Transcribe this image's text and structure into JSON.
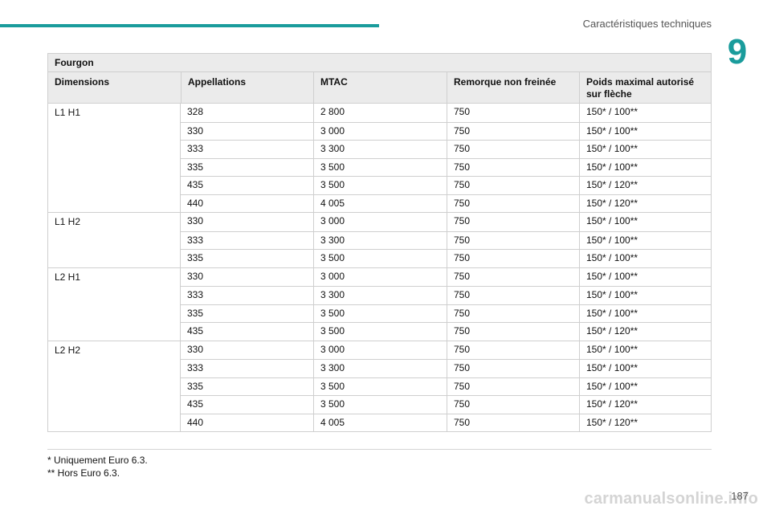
{
  "header": {
    "title": "Caractéristiques techniques",
    "chapter": "9"
  },
  "table": {
    "title": "Fourgon",
    "columns": [
      "Dimensions",
      "Appellations",
      "MTAC",
      "Remorque non freinée",
      "Poids maximal autorisé sur flèche"
    ],
    "groups": [
      {
        "dimension": "L1 H1",
        "rows": [
          [
            "328",
            "2 800",
            "750",
            "150* / 100**"
          ],
          [
            "330",
            "3 000",
            "750",
            "150* / 100**"
          ],
          [
            "333",
            "3 300",
            "750",
            "150* / 100**"
          ],
          [
            "335",
            "3 500",
            "750",
            "150* / 100**"
          ],
          [
            "435",
            "3 500",
            "750",
            "150* / 120**"
          ],
          [
            "440",
            "4 005",
            "750",
            "150* / 120**"
          ]
        ]
      },
      {
        "dimension": "L1 H2",
        "rows": [
          [
            "330",
            "3 000",
            "750",
            "150* / 100**"
          ],
          [
            "333",
            "3 300",
            "750",
            "150* / 100**"
          ],
          [
            "335",
            "3 500",
            "750",
            "150* / 100**"
          ]
        ]
      },
      {
        "dimension": "L2 H1",
        "rows": [
          [
            "330",
            "3 000",
            "750",
            "150* / 100**"
          ],
          [
            "333",
            "3 300",
            "750",
            "150* / 100**"
          ],
          [
            "335",
            "3 500",
            "750",
            "150* / 100**"
          ],
          [
            "435",
            "3 500",
            "750",
            "150* / 120**"
          ]
        ]
      },
      {
        "dimension": "L2 H2",
        "rows": [
          [
            "330",
            "3 000",
            "750",
            "150* / 100**"
          ],
          [
            "333",
            "3 300",
            "750",
            "150* / 100**"
          ],
          [
            "335",
            "3 500",
            "750",
            "150* / 100**"
          ],
          [
            "435",
            "3 500",
            "750",
            "150* / 120**"
          ],
          [
            "440",
            "4 005",
            "750",
            "150* / 120**"
          ]
        ]
      }
    ]
  },
  "footnotes": [
    "* Uniquement Euro 6.3.",
    "** Hors Euro 6.3."
  ],
  "page_number": "187",
  "watermark": "carmanualsonline.info",
  "colors": {
    "accent": "#1a9c9c",
    "header_bg": "#ebebeb"
  }
}
